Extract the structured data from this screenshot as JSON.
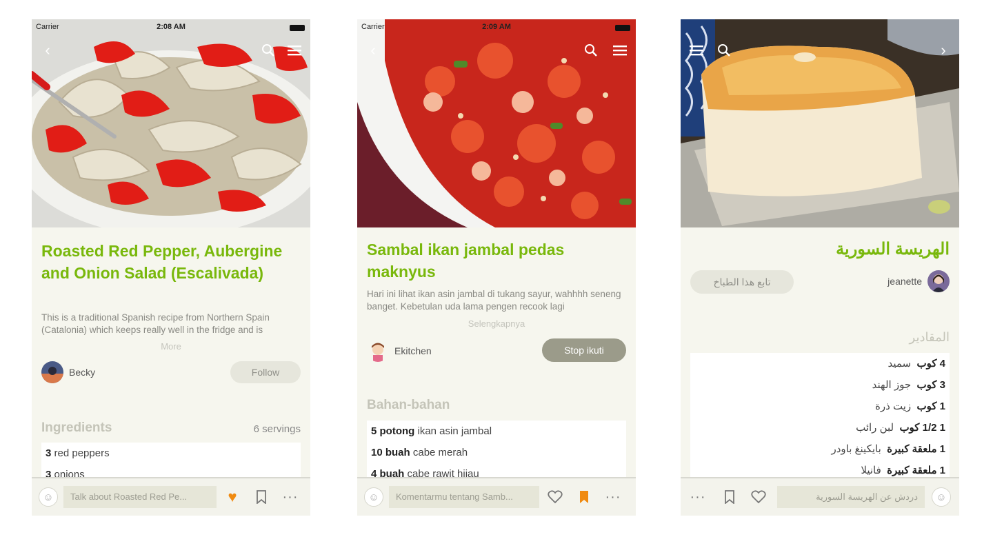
{
  "colors": {
    "accent_green": "#79b80c",
    "orange": "#f08a10",
    "screen_bg": "#f6f6ee",
    "follow_bg": "#e6e6dc",
    "unfollow_bg": "#9b9b8a"
  },
  "screens": [
    {
      "status": {
        "carrier": "Carrier",
        "time": "2:08 AM"
      },
      "nav_icons": [
        "back-chevron-icon",
        "search-icon",
        "menu-icon"
      ],
      "title": "Roasted Red Pepper, Aubergine and Onion Salad (Escalivada)",
      "description": "This is a traditional Spanish recipe from Northern Spain (Catalonia) which keeps really well in the fridge and is",
      "more_label": "More",
      "author": "Becky",
      "follow_label": "Follow",
      "ingredients_heading": "Ingredients",
      "servings": "6 servings",
      "ingredients": [
        {
          "qty": "3",
          "item": "red peppers"
        },
        {
          "qty": "3",
          "item": "onions"
        }
      ],
      "comment_placeholder": "Talk about Roasted Red Pe...",
      "liked": true,
      "bookmarked": false
    },
    {
      "status": {
        "carrier": "Carrier",
        "time": "2:09 AM"
      },
      "nav_icons": [
        "back-chevron-icon",
        "search-icon",
        "menu-icon"
      ],
      "title": "Sambal ikan jambal pedas maknyus",
      "description": "Hari ini lihat ikan asin jambal di tukang sayur, wahhhh seneng banget. Kebetulan uda lama pengen recook lagi",
      "more_label": "Selengkapnya",
      "author": "Ekitchen",
      "follow_label": "Stop ikuti",
      "ingredients_heading": "Bahan-bahan",
      "ingredients": [
        {
          "qty": "5 potong",
          "item": "ikan asin jambal"
        },
        {
          "qty": "10 buah",
          "item": "cabe merah"
        },
        {
          "qty": "4 buah",
          "item": "cabe rawit hijau"
        }
      ],
      "comment_placeholder": "Komentarmu tentang Samb...",
      "liked": false,
      "bookmarked": true
    },
    {
      "nav_icons": [
        "menu-icon",
        "search-icon",
        "forward-chevron-icon"
      ],
      "title": "الهريسة السورية",
      "follow_label": "تابع هذا الطباخ",
      "author": "jeanette",
      "ingredients_heading": "المقادير",
      "ingredients": [
        {
          "qty": "4 كوب",
          "item": "سميد"
        },
        {
          "qty": "3 كوب",
          "item": "جوز الهند"
        },
        {
          "qty": "1 كوب",
          "item": "زيت ذرة"
        },
        {
          "qty": "1 1/2 كوب",
          "item": "لبن رائب"
        },
        {
          "qty": "1 ملعقة كبيرة",
          "item": "بايكينغ باودر"
        },
        {
          "qty": "1 ملعقة كبيرة",
          "item": "فانيلا"
        }
      ],
      "comment_placeholder": "دردش عن الهريسة السورية",
      "liked": false,
      "bookmarked": false
    }
  ]
}
